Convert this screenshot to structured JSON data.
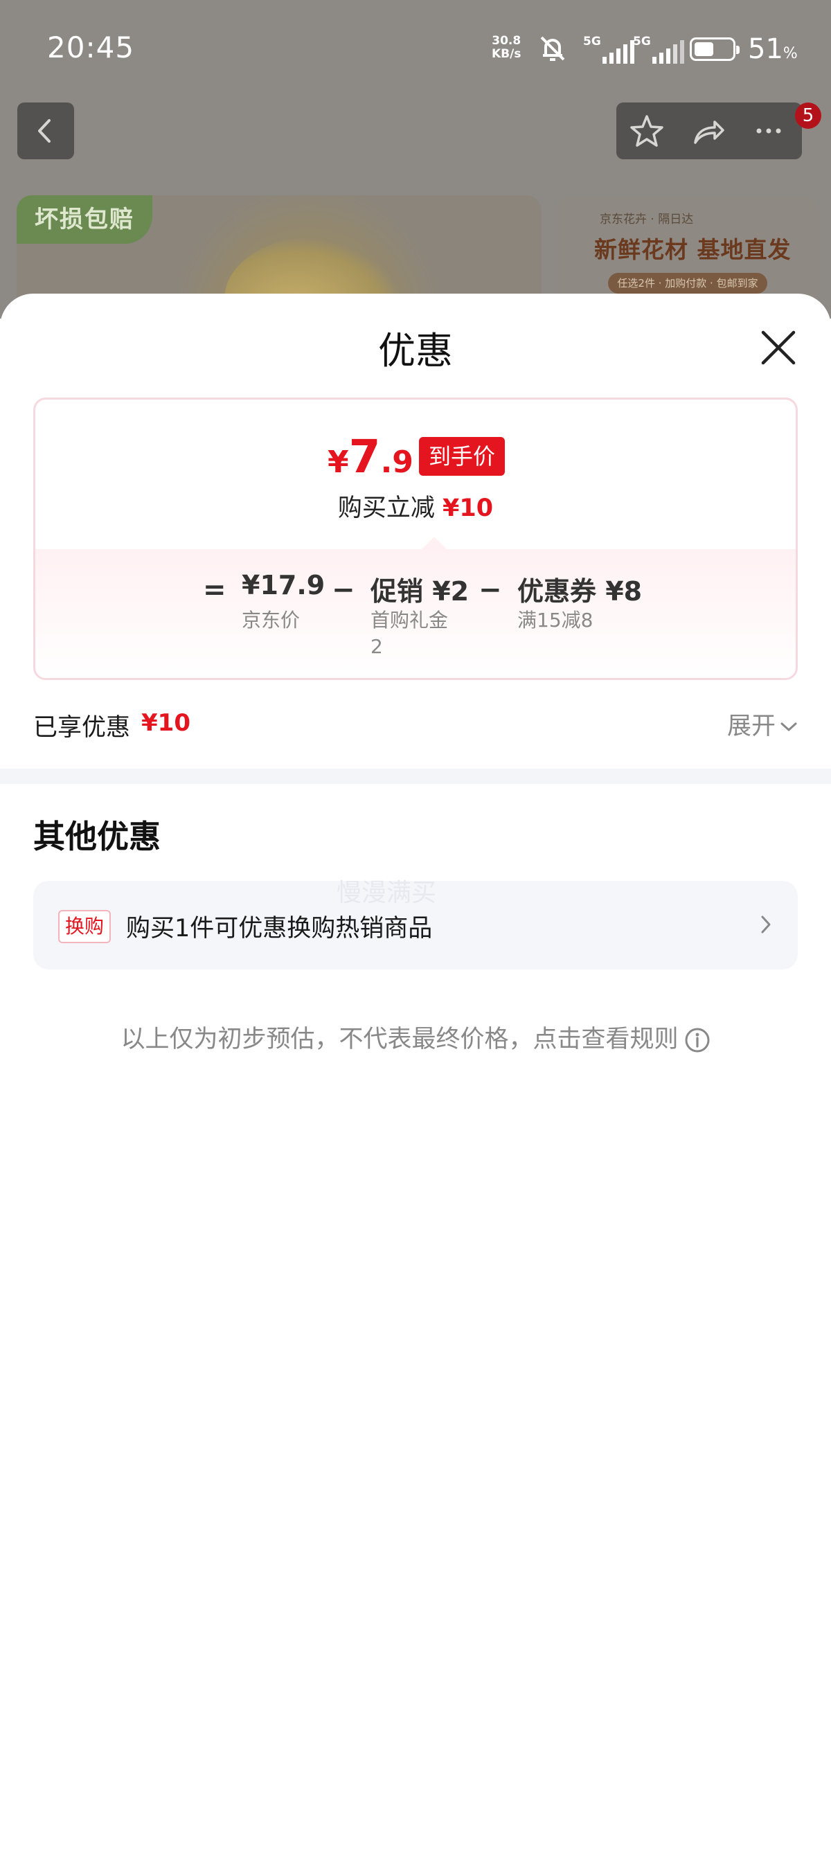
{
  "status_bar": {
    "time": "20:45",
    "net_speed_value": "30.8",
    "net_speed_unit": "KB/s",
    "sim1_label": "5G",
    "sim2_label": "5G",
    "battery_percent": "51",
    "battery_unit": "%",
    "battery_level": 0.51
  },
  "background_page": {
    "badge": "坏损包赔",
    "banner_headline": "新鲜花材 基地直发",
    "banner_pills": "任选2件 · 加购付款 · 包邮到家",
    "nav_badge_count": "5"
  },
  "sheet": {
    "title": "优惠",
    "final_price": {
      "currency": "¥",
      "integer": "7",
      "decimal": ".9",
      "tag": "到手价"
    },
    "instant_discount_label": "购买立减",
    "instant_discount_value": "¥10",
    "breakdown": {
      "equals": "=",
      "minus": "−",
      "items": [
        {
          "value": "¥17.9",
          "label": "京东价"
        },
        {
          "value": "促销 ¥2",
          "label_line1": "首购礼金",
          "label_line2": "2"
        },
        {
          "value": "优惠券 ¥8",
          "label": "满15减8"
        }
      ]
    },
    "enjoyed_label": "已享优惠",
    "enjoyed_value": "¥10",
    "expand_label": "展开",
    "other_title": "其他优惠",
    "watermark": "慢漫满买",
    "offer": {
      "tag": "换购",
      "text": "购买1件可优惠换购热销商品"
    },
    "disclaimer": "以上仅为初步预估，不代表最终价格，点击查看规则"
  },
  "colors": {
    "accent_red": "#e4151e",
    "dim_overlay": "#8d8a86",
    "card_border": "#f6d9de"
  }
}
